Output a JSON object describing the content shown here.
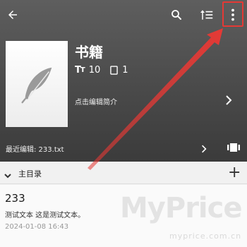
{
  "colors": {
    "header_top": "#5e5e5e",
    "header_bottom": "#3b3b3b",
    "annotation": "#e53935",
    "background": "#f3f3f3"
  },
  "toolbar": {
    "back_icon": "arrow-left-icon",
    "search_icon": "search-icon",
    "sort_icon": "sort-icon",
    "more_icon": "more-vertical-icon"
  },
  "book": {
    "title": "书籍",
    "cover_icon": "feather-icon",
    "font_count_icon": "text-size-icon",
    "font_count": "10",
    "chapter_count_icon": "document-icon",
    "chapter_count": "1",
    "intro_label": "点击编辑简介"
  },
  "recent": {
    "label": "最近编辑: 233.txt"
  },
  "toc": {
    "label": "主目录",
    "add_label": "+"
  },
  "chapter": {
    "title": "233",
    "preview": "测试文本 这是测试文本。",
    "date": "2024-01-08 16:43"
  },
  "watermark": {
    "main": "MyPrice",
    "sub": "myprice.com.cn"
  }
}
